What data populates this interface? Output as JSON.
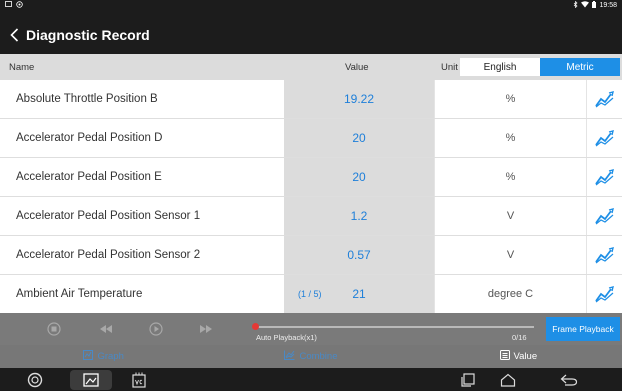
{
  "status_bar": {
    "time": "19:58",
    "left_icons": [
      "notification-icon",
      "settings-status-icon"
    ],
    "right_icons": [
      "bluetooth-icon",
      "wifi-icon",
      "battery-icon"
    ]
  },
  "header": {
    "title": "Diagnostic Record"
  },
  "columns": {
    "name": "Name",
    "value": "Value",
    "unit": "Unit"
  },
  "unit_toggle": {
    "english": "English",
    "metric": "Metric",
    "selected": "Metric"
  },
  "rows": [
    {
      "name": "Absolute Throttle Position B",
      "value": "19.22",
      "unit": "%"
    },
    {
      "name": "Accelerator Pedal Position D",
      "value": "20",
      "unit": "%"
    },
    {
      "name": "Accelerator Pedal Position E",
      "value": "20",
      "unit": "%"
    },
    {
      "name": "Accelerator Pedal Position Sensor 1",
      "value": "1.2",
      "unit": "V"
    },
    {
      "name": "Accelerator Pedal Position Sensor 2",
      "value": "0.57",
      "unit": "V"
    },
    {
      "name": "Ambient Air Temperature",
      "value": "21",
      "unit": "degree C"
    }
  ],
  "page_indicator": "(1 / 5)",
  "playback": {
    "mode_label": "Auto Playback(x1)",
    "frame_counter": "0/16",
    "frame_button": "Frame Playback",
    "progress_fraction": 0.0
  },
  "tabs": [
    {
      "label": "Graph",
      "icon": "graph-icon"
    },
    {
      "label": "Combine",
      "icon": "combine-icon"
    },
    {
      "label": "Value",
      "icon": "value-icon"
    }
  ],
  "colors": {
    "accent": "#1e8fe6",
    "value_text": "#1e7fd9",
    "header_bg": "#1c1c1c"
  }
}
